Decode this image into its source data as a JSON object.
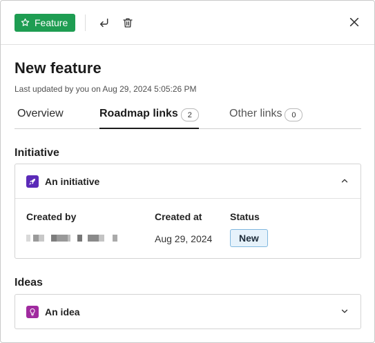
{
  "header": {
    "feature_button_label": "Feature"
  },
  "title": "New feature",
  "subtitle": "Last updated by you on Aug 29, 2024 5:05:26 PM",
  "tabs": [
    {
      "label": "Overview",
      "count": null
    },
    {
      "label": "Roadmap links",
      "count": "2"
    },
    {
      "label": "Other links",
      "count": "0"
    }
  ],
  "initiative_section": {
    "label": "Initiative",
    "item_title": "An initiative",
    "columns": {
      "created_by_header": "Created by",
      "created_at_header": "Created at",
      "status_header": "Status",
      "created_at_value": "Aug 29, 2024",
      "status_value": "New"
    }
  },
  "ideas_section": {
    "label": "Ideas",
    "item_title": "An idea"
  },
  "colors": {
    "feature_green": "#1e9d52",
    "initiative_purple": "#5b2ab8",
    "idea_magenta": "#a02a9f",
    "status_bg": "#e6f2fb",
    "status_border": "#7fb7de"
  },
  "icons": {
    "feature": "star-outline-icon",
    "convert": "return-arrow-icon",
    "delete": "trash-icon",
    "close": "close-icon",
    "initiative": "rocket-icon",
    "idea": "lightbulb-icon",
    "expand": "chevron-icon"
  }
}
